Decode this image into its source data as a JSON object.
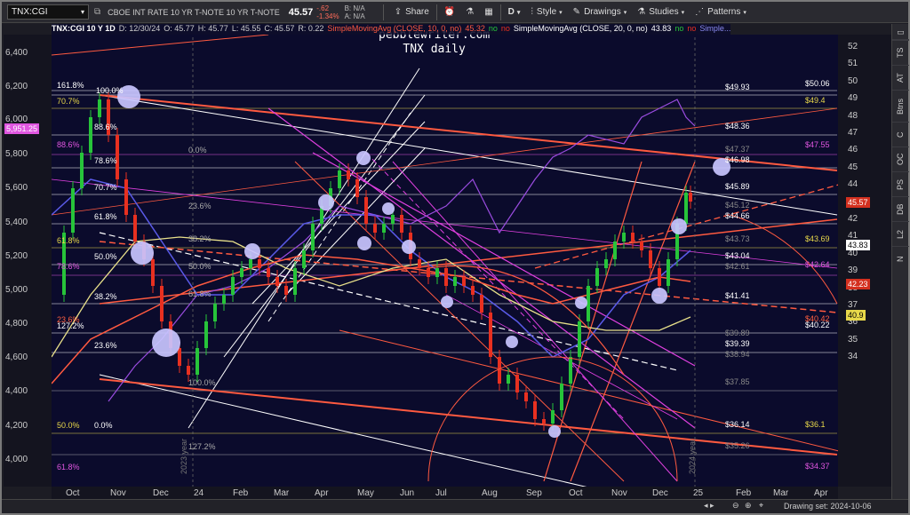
{
  "toolbar": {
    "symbol": "TNX:CGI",
    "description": "CBOE INT RATE 10 YR T-NOTE   10 YR T-NOTE",
    "last": "45.57",
    "change": "-.62",
    "change_pct": "-1.34%",
    "bid": "B: N/A",
    "ask": "A: N/A",
    "share": "Share",
    "period": "D",
    "style": "Style",
    "drawings": "Drawings",
    "studies": "Studies",
    "patterns": "Patterns"
  },
  "info": {
    "symbol": "TNX:CGI 10 Y 1D",
    "date": "D: 12/30/24",
    "open": "O: 45.77",
    "high": "H: 45.77",
    "low": "L: 45.55",
    "close": "C: 45.57",
    "range": "R: 0.22",
    "sma10": "SimpleMovingAvg (CLOSE, 10, 0, no)",
    "sma10_val": "45.32",
    "sma20": "SimpleMovingAvg (CLOSE, 20, 0, no)",
    "sma20_val": "43.83",
    "no": "no",
    "more": "Simple..."
  },
  "annotation": {
    "line1": "pebblewriter.com",
    "line2": "TNX daily"
  },
  "left_axis": [
    "6,400",
    "6,200",
    "6,000",
    "5,800",
    "5,600",
    "5,400",
    "5,200",
    "5,000",
    "4,800",
    "4,600",
    "4,400",
    "4,200",
    "4,000"
  ],
  "left_tag": "5,951.25",
  "right_axis": [
    "52",
    "51",
    "50",
    "49",
    "48",
    "47",
    "46",
    "45",
    "44",
    "43",
    "42",
    "41",
    "40",
    "39",
    "38",
    "37",
    "36",
    "35",
    "34"
  ],
  "right_tags": [
    {
      "text": "45.57",
      "bg": "#d4301f"
    },
    {
      "text": "43.83",
      "bg": "#ffffff",
      "fg": "#000"
    },
    {
      "text": "42.23",
      "bg": "#d4301f"
    },
    {
      "text": "40.9",
      "bg": "#e8d84a",
      "fg": "#000"
    }
  ],
  "x_axis": [
    "Oct",
    "Nov",
    "Dec",
    "24",
    "Feb",
    "Mar",
    "Apr",
    "May",
    "Jun",
    "Jul",
    "Aug",
    "Sep",
    "Oct",
    "Nov",
    "Dec",
    "25",
    "Feb",
    "Mar",
    "Apr"
  ],
  "fib_left": [
    {
      "t": "161.8%",
      "c": "#ffffff"
    },
    {
      "t": "100.0%",
      "c": "#ffffff"
    },
    {
      "t": "70.7%",
      "c": "#e8d84a"
    },
    {
      "t": "88.6%",
      "c": "#ffffff"
    },
    {
      "t": "88.6%",
      "c": "#e056e0"
    },
    {
      "t": "78.6%",
      "c": "#ffffff"
    },
    {
      "t": "0.0%",
      "c": "#aaaaaa"
    },
    {
      "t": "70.7%",
      "c": "#ffffff"
    },
    {
      "t": "23.6%",
      "c": "#aaaaaa"
    },
    {
      "t": "61.8%",
      "c": "#ffffff"
    },
    {
      "t": "61.8%",
      "c": "#e8d84a"
    },
    {
      "t": "38.2%",
      "c": "#aaaaaa"
    },
    {
      "t": "50.0%",
      "c": "#ffffff"
    },
    {
      "t": "78.6%",
      "c": "#e056e0"
    },
    {
      "t": "50.0%",
      "c": "#aaaaaa"
    },
    {
      "t": "38.2%",
      "c": "#ffffff"
    },
    {
      "t": "61.8%",
      "c": "#aaaaaa"
    },
    {
      "t": "23.6%",
      "c": "#ff6040"
    },
    {
      "t": "127.2%",
      "c": "#ffffff"
    },
    {
      "t": "23.6%",
      "c": "#ffffff"
    },
    {
      "t": "100.0%",
      "c": "#aaaaaa"
    },
    {
      "t": "0.0%",
      "c": "#ffffff"
    },
    {
      "t": "50.0%",
      "c": "#e8d84a"
    },
    {
      "t": "127.2%",
      "c": "#aaaaaa"
    },
    {
      "t": "61.8%",
      "c": "#e056e0"
    }
  ],
  "levels_mid": [
    {
      "t": "$49.93",
      "c": "#ffffff"
    },
    {
      "t": "$48.36",
      "c": "#ffffff"
    },
    {
      "t": "$47.37",
      "c": "#888888"
    },
    {
      "t": "$46.98",
      "c": "#ffffff"
    },
    {
      "t": "$45.89",
      "c": "#ffffff"
    },
    {
      "t": "$45.12",
      "c": "#888888"
    },
    {
      "t": "$44.66",
      "c": "#ffffff"
    },
    {
      "t": "$43.73",
      "c": "#888888"
    },
    {
      "t": "$43.04",
      "c": "#ffffff"
    },
    {
      "t": "$42.61",
      "c": "#888888"
    },
    {
      "t": "$41.41",
      "c": "#ffffff"
    },
    {
      "t": "$39.89",
      "c": "#888888"
    },
    {
      "t": "$39.39",
      "c": "#ffffff"
    },
    {
      "t": "$38.94",
      "c": "#888888"
    },
    {
      "t": "$37.85",
      "c": "#888888"
    },
    {
      "t": "$36.14",
      "c": "#ffffff"
    },
    {
      "t": "$35.26",
      "c": "#888888"
    }
  ],
  "levels_right": [
    {
      "t": "$50.06",
      "c": "#ffffff"
    },
    {
      "t": "$49.4",
      "c": "#e8d84a"
    },
    {
      "t": "$47.55",
      "c": "#e056e0"
    },
    {
      "t": "$43.69",
      "c": "#e8d84a"
    },
    {
      "t": "$42.64",
      "c": "#e056e0"
    },
    {
      "t": "$40.42",
      "c": "#ff6040"
    },
    {
      "t": "$40.22",
      "c": "#ffffff"
    },
    {
      "t": "$36.1",
      "c": "#e8d84a"
    },
    {
      "t": "$34.37",
      "c": "#e056e0"
    }
  ],
  "year_labels": [
    "2023 year",
    "2024 year"
  ],
  "sidebar": [
    "TS",
    "AT",
    "Btns",
    "C",
    "OC",
    "PS",
    "DB",
    "L2",
    "N"
  ],
  "status": {
    "drawing_set": "Drawing set: 2024-10-06"
  },
  "colors": {
    "background": "#0b0b2c",
    "candle_up": "#27c43a",
    "candle_down": "#e83020",
    "sma_red": "#ff5a40",
    "sma_blue": "#5a5ae8",
    "sma_yellow": "#e8e08a",
    "spx_purple": "#9a4ce0",
    "fib_white": "#ffffff",
    "fan_pink": "#e040e0"
  }
}
